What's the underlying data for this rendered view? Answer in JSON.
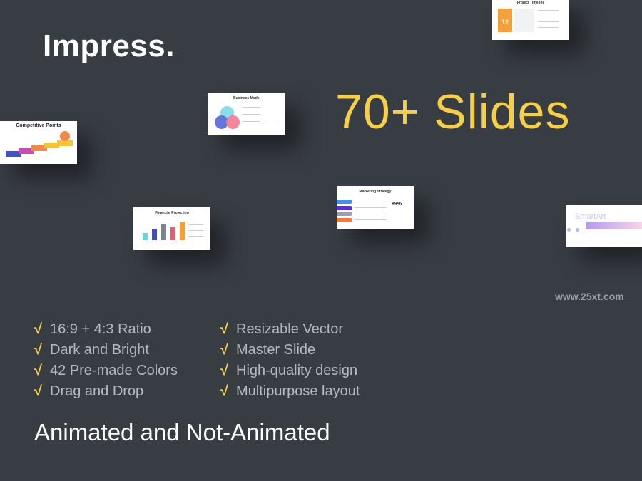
{
  "brand": "Impress.",
  "headline": "70+ Slides",
  "website": "www.25xt.com",
  "features_left": [
    "16:9 + 4:3 Ratio",
    "Dark and Bright",
    "42 Pre-made Colors",
    "Drag and Drop"
  ],
  "features_right": [
    "Resizable Vector",
    "Master Slide",
    "High-quality design",
    "Multipurpose layout"
  ],
  "check_mark": "√",
  "tagline": "Animated and Not-Animated",
  "slides": {
    "project_timeline": {
      "title": "Project Timeline",
      "number": "12"
    },
    "business_model": {
      "title": "Business Model"
    },
    "competitive_points": {
      "title": "Competitive Points"
    },
    "financial_projection": {
      "title": "Financial Projection"
    },
    "marketing_strategy": {
      "title": "Marketing Strategy",
      "stat": "89%"
    },
    "smartart": {
      "title": "SmartArt"
    }
  },
  "colors": {
    "background": "#383d44",
    "accent": "#f6cf4a",
    "feature_text": "#b6bac0"
  }
}
